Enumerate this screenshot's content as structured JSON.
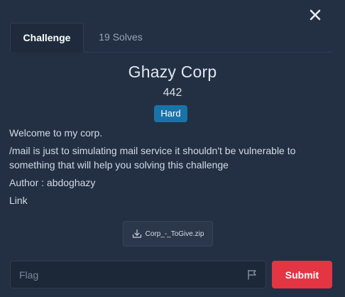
{
  "tabs": [
    {
      "label": "Challenge",
      "active": true
    },
    {
      "label": "19 Solves",
      "active": false
    }
  ],
  "challenge": {
    "title": "Ghazy Corp",
    "points": "442",
    "difficulty": "Hard",
    "description": [
      "Welcome to my corp.",
      "/mail is just to simulating mail service it shouldn't be vulnerable to something that will help you solving this challenge",
      "Author : abdoghazy",
      "Link"
    ],
    "file": {
      "name": "Corp_-_ToGive.zip",
      "icon": "download-icon"
    }
  },
  "flag_form": {
    "placeholder": "Flag",
    "value": "",
    "icon": "flag-icon",
    "submit_label": "Submit"
  },
  "colors": {
    "background": "#233044",
    "badge_hard": "#1a73a8",
    "submit": "#e33542"
  },
  "icons": {
    "close": "close-icon"
  }
}
